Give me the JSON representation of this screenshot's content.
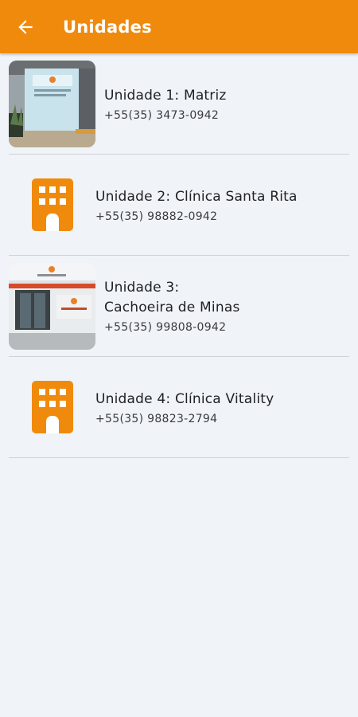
{
  "appbar": {
    "title": "Unidades",
    "back_icon": "arrow-left-icon",
    "color": "#f08a0c"
  },
  "units": [
    {
      "name": "Unidade 1: Matriz",
      "phone": "+55(35) 3473-0942",
      "media": "photo"
    },
    {
      "name": "Unidade 2: Clínica Santa Rita",
      "phone": "+55(35) 98882-0942",
      "media": "building-icon"
    },
    {
      "name": "Unidade 3:\nCachoeira de Minas",
      "phone": "+55(35) 99808-0942",
      "media": "photo"
    },
    {
      "name": "Unidade 4: Clínica Vitality",
      "phone": "+55(35) 98823-2794",
      "media": "building-icon"
    }
  ]
}
